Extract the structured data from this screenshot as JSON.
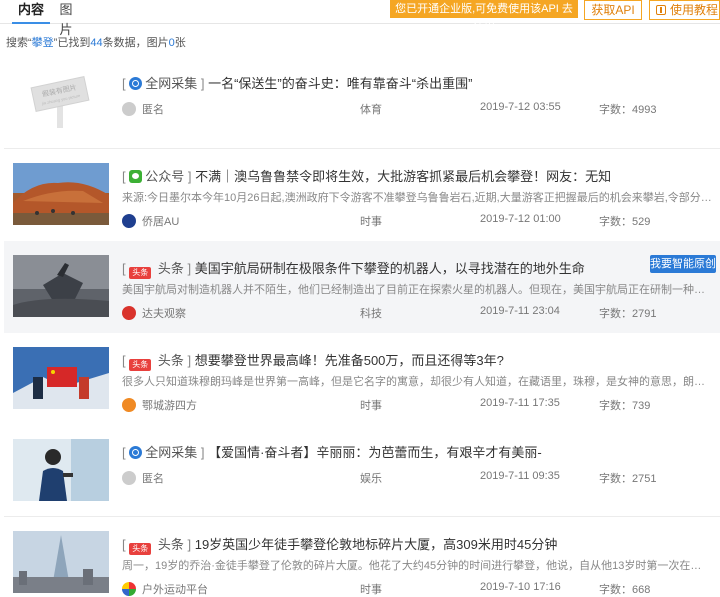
{
  "tabs": {
    "content": "内容",
    "images": "图片"
  },
  "promo_text": "您已开通企业版,可免费使用该API 去使用",
  "buttons": {
    "get_api": "获取API",
    "tutorial": "使用教程"
  },
  "summary": {
    "prefix": "搜索“",
    "keyword": "攀登",
    "mid": "”已找到",
    "count": "44",
    "mid2": "条数据，图片",
    "images": "0",
    "suffix": "张"
  },
  "placeholder": {
    "line1": "假装有图片",
    "line2": "jia zhuang you picture"
  },
  "colors": {
    "accent": "#2b7ad6",
    "promo": "#f5a623",
    "toutiao": "#e8403d",
    "wechat": "#3cb034"
  },
  "results": [
    {
      "source": "全网采集",
      "source_icon": "globe-icon",
      "title": "一名“保送生”的奋斗史：唯有靠奋斗“杀出重围”",
      "description": "",
      "author": "匿名",
      "category": "体育",
      "date": "2019-7-12 03:55",
      "word_count": "字数：4993"
    },
    {
      "source": "公众号",
      "source_icon": "wechat-icon",
      "title": "不满｜澳乌鲁鲁禁令即将生效，大批游客抓紧最后机会攀登！网友：无知",
      "description": "来源:今日墨尔本今年10月26日起,澳洲政府下令游客不准攀登乌鲁鲁岩石,近期,大量游客正把握最后的机会来攀岩,令部分澳人不...",
      "author": "侨居AU",
      "category": "时事",
      "date": "2019-7-12 01:00",
      "word_count": "字数：529"
    },
    {
      "source": "头条",
      "source_icon": "toutiao-icon",
      "source_tag": "头条",
      "title": "美国宇航局研制在极限条件下攀登的机器人，以寻找潜在的地外生命",
      "description": "美国宇航局对制造机器人并不陌生，他们已经制造出了目前正在探索火星的机器人。但现在，美国宇航局正在研制一种机器人，这种机器人不...",
      "author": "达夫观察",
      "category": "科技",
      "date": "2019-7-11 23:04",
      "word_count": "字数：2791",
      "badge": "我要智能原创"
    },
    {
      "source": "头条",
      "source_icon": "toutiao-icon",
      "source_tag": "头条",
      "title": "想要攀登世界最高峰！先准备500万，而且还得等3年?",
      "description": "很多人只知道珠穆朗玛峰是世界第一高峰，但是它名字的寓意，却很少有人知道，在藏语里，珠穆，是女神的意思，朗玛，是第三的意思，因...",
      "author": "鄂城游四方",
      "category": "时事",
      "date": "2019-7-11 17:35",
      "word_count": "字数：739"
    },
    {
      "source": "全网采集",
      "source_icon": "globe-icon",
      "title": "【爱国情·奋斗者】辛丽丽：为芭蕾而生，有艰辛才有美丽-",
      "description": "",
      "author": "匿名",
      "category": "娱乐",
      "date": "2019-7-11 09:35",
      "word_count": "字数：2751"
    },
    {
      "source": "头条",
      "source_icon": "toutiao-icon",
      "source_tag": "头条",
      "title": "19岁英国少年徒手攀登伦敦地标碎片大厦，高309米用时45分钟",
      "description": "周一，19岁的乔治·金徒手攀登了伦敦的碎片大厦。他花了大约45分钟的时间进行攀登，他说，自从他13岁时第一次在学校旅行时看到碎片大...",
      "author": "户外运动平台",
      "category": "时事",
      "date": "2019-7-10 17:16",
      "word_count": "字数：668"
    }
  ]
}
